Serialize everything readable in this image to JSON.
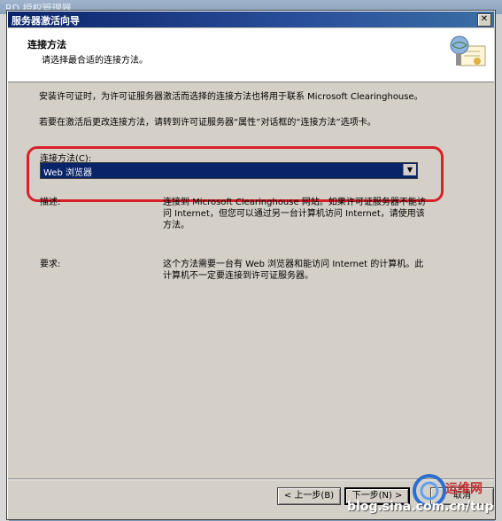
{
  "background_window": {
    "title": "RD 授权管理器"
  },
  "dialog": {
    "title": "服务器激活向导",
    "close_glyph": "✕",
    "header": {
      "title": "连接方法",
      "subtitle": "请选择最合适的连接方法。",
      "icon": "certificate-globe-icon"
    },
    "intro_text": "安装许可证时，为许可证服务器激活而选择的连接方法也将用于联系 Microsoft Clearinghouse。",
    "change_text": "若要在激活后更改连接方法，请转到许可证服务器“属性”对话框的“连接方法”选项卡。",
    "connection_method": {
      "label": "连接方法(C):",
      "selected": "Web 浏览器"
    },
    "description": {
      "label": "描述:",
      "text": "连接到 Microsoft Clearinghouse 网站。如果许可证服务器不能访问 Internet，但您可以通过另一台计算机访问 Internet，请使用该方法。"
    },
    "requirements": {
      "label": "要求:",
      "text": "这个方法需要一台有 Web 浏览器和能访问 Internet 的计算机。此计算机不一定要连接到许可证服务器。"
    },
    "buttons": {
      "back": "< 上一步(B)",
      "next": "下一步(N) >",
      "cancel": "取消"
    }
  },
  "watermark": {
    "site_cn": "运维网",
    "url": "blog.sina.com.cn/tup"
  },
  "colors": {
    "highlight": "#d8202a",
    "selection": "#0a246a",
    "title_bar": "#0a246a"
  }
}
